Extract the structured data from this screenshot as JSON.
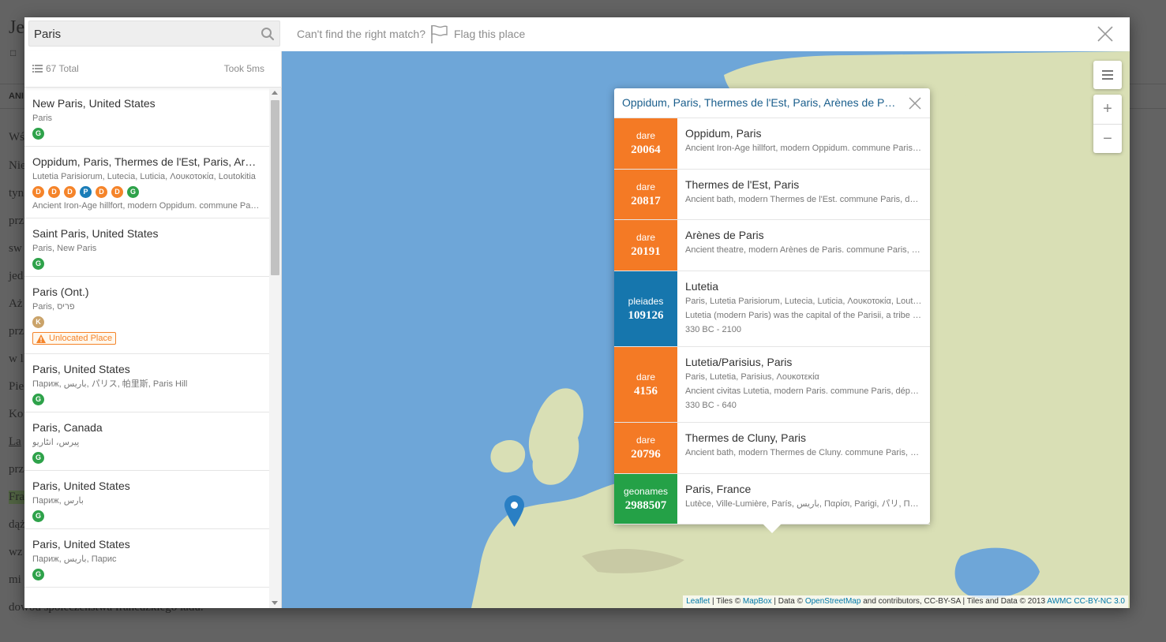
{
  "background": {
    "title": "Je",
    "bar_label": "ANI",
    "lines": [
      "Wś",
      "Nie",
      "tyn",
      "prz",
      "sw",
      "jed",
      "Aż",
      "prz",
      "w l",
      "Pie",
      "Ko",
      "La",
      "prz",
      "Fra",
      "dąż",
      "wz",
      "mi",
      "dowód społeczeństwa francuzkiego ładu."
    ]
  },
  "search": {
    "value": "Paris",
    "cant_find": "Can't find the right match?",
    "flag_label": "Flag this place"
  },
  "results_meta": {
    "total": "67 Total",
    "took": "Took 5ms"
  },
  "results": [
    {
      "title": "New Paris, United States",
      "names": "Paris",
      "badges": [
        "G"
      ]
    },
    {
      "title": "Oppidum, Paris, Thermes de l'Est, Paris, Arènes de Paris, Lutetia",
      "names": "Lutetia Parisiorum, Lutecia, Luticia, Λουκοτοκία, Loutokitia",
      "badges": [
        "D",
        "D",
        "D",
        "P",
        "D",
        "D",
        "G"
      ],
      "desc": "Ancient Iron-Age hillfort, modern Oppidum. commune Paris, département"
    },
    {
      "title": "Saint Paris, United States",
      "names": "Paris, New Paris",
      "badges": [
        "G"
      ]
    },
    {
      "title": "Paris (Ont.)",
      "names": "Paris, פריס",
      "badges": [
        "K"
      ],
      "flag": "Unlocated Place"
    },
    {
      "title": "Paris, United States",
      "names": "Париж, باریس, パリス, 帕里斯, Paris Hill",
      "badges": [
        "G"
      ]
    },
    {
      "title": "Paris, Canada",
      "names": "پیرس، انٹاریو",
      "badges": [
        "G"
      ]
    },
    {
      "title": "Paris, United States",
      "names": "Париж, بارس",
      "badges": [
        "G"
      ]
    },
    {
      "title": "Paris, United States",
      "names": "Париж, باریس, Парис",
      "badges": [
        "G"
      ]
    }
  ],
  "popup": {
    "title": "Oppidum, Paris, Thermes de l'Est, Paris, Arènes de Paris, Lutetia",
    "rows": [
      {
        "source": "dare",
        "id": "20064",
        "title": "Oppidum, Paris",
        "lines": [
          "Ancient Iron-Age hillfort, modern Oppidum. commune Paris, département"
        ]
      },
      {
        "source": "dare",
        "id": "20817",
        "title": "Thermes de l'Est, Paris",
        "lines": [
          "Ancient bath, modern Thermes de l'Est. commune Paris, département"
        ]
      },
      {
        "source": "dare",
        "id": "20191",
        "title": "Arènes de Paris",
        "lines": [
          "Ancient theatre, modern Arènes de Paris. commune Paris, département"
        ]
      },
      {
        "source": "pleiades",
        "id": "109126",
        "title": "Lutetia",
        "lines": [
          "Paris, Lutetia Parisiorum, Lutecia, Luticia, Λουκοτοκία, Loutokitia",
          "Lutetia (modern Paris) was the capital of the Parisii, a tribe of Gaul",
          "330 BC - 2100"
        ]
      },
      {
        "source": "dare",
        "id": "4156",
        "title": "Lutetia/Parisius, Paris",
        "lines": [
          "Paris, Lutetia, Parisius, Λουκοτεκία",
          "Ancient civitas Lutetia, modern Paris. commune Paris, département",
          "330 BC - 640"
        ]
      },
      {
        "source": "dare",
        "id": "20796",
        "title": "Thermes de Cluny, Paris",
        "lines": [
          "Ancient bath, modern Thermes de Cluny. commune Paris, département"
        ]
      },
      {
        "source": "geonames",
        "id": "2988507",
        "title": "Paris, France",
        "lines": [
          "Lutèce, Ville-Lumière, París, باريس, Παρίσι, Parigi, パリ, Παρίσι"
        ]
      }
    ]
  },
  "map": {
    "attribution": {
      "leaflet": "Leaflet",
      "tiles": "Tiles ©",
      "mapbox": "MapBox",
      "data": "Data ©",
      "osm": "OpenStreetMap",
      "rest": "and contributors, CC-BY-SA | Tiles and Data © 2013",
      "awmc": "AWMC CC-BY-NC 3.0"
    }
  },
  "colors": {
    "dare": "#f47a25",
    "pleiades": "#1676ad",
    "geonames": "#24a147",
    "water": "#6ea6d8",
    "land": "#d9dfb5"
  }
}
